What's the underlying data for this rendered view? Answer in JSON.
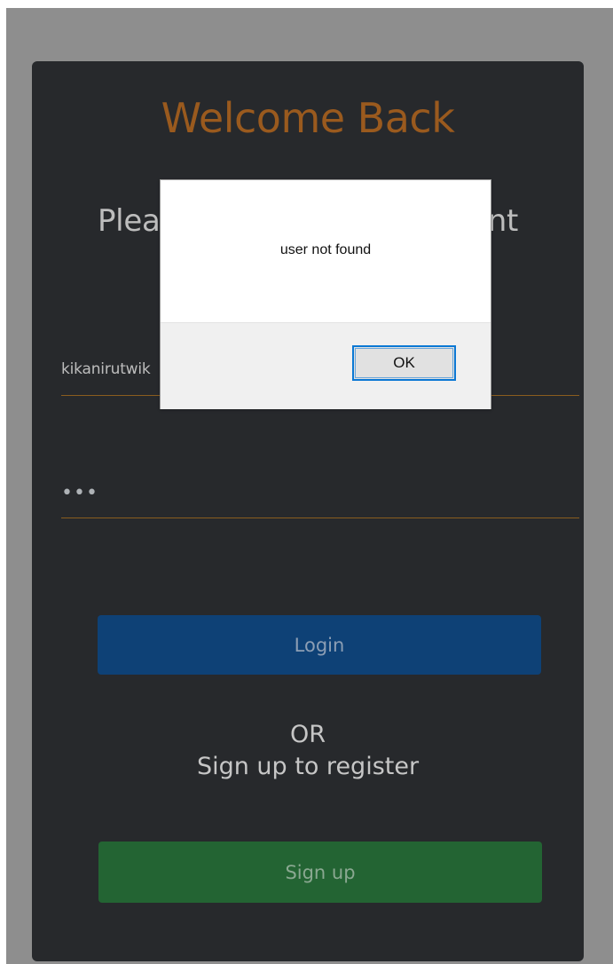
{
  "login_card": {
    "heading": "Welcome Back",
    "subtitle": "Please login to your account"
  },
  "form": {
    "username_value": "kikanirutwik",
    "password_value": "abc",
    "login_label": "Login",
    "or_text": "OR",
    "register_prompt": "Sign up to register",
    "signup_label": "Sign up"
  },
  "alert": {
    "message": "user not found",
    "ok_label": "OK"
  },
  "colors": {
    "background": "#8e8e8e",
    "card": "#27292c",
    "heading_accent": "#9a5a1e",
    "input_underline": "#8a5d1f",
    "login_button": "#0e4176",
    "signup_button": "#236433",
    "dialog_button_focus": "#0b78d4"
  }
}
